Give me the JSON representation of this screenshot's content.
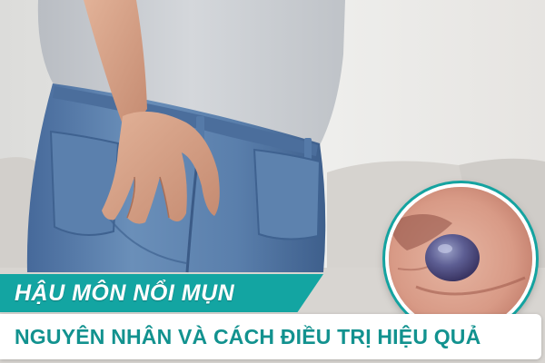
{
  "banner": {
    "title": "HẬU MÔN NỔI MỤN",
    "subtitle": "NGUYÊN NHÂN VÀ CÁCH ĐIỀU TRỊ HIỆU QUẢ"
  },
  "colors": {
    "accent": "#13a5a2",
    "subtitle_text": "#12928f",
    "denim": "#5d82ad",
    "shirt": "#c9ccd0",
    "sofa": "#d9d6d2",
    "skin": "#d9a58c"
  },
  "images": {
    "main_photo": "person-in-jeans-hand-on-buttock",
    "inset_photo": "closeup-bluish-lump-on-skin"
  }
}
